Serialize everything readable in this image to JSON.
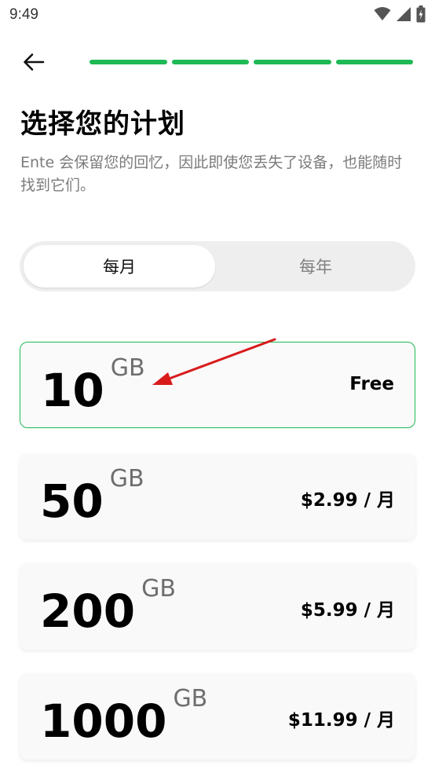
{
  "status_bar": {
    "time": "9:49",
    "icons": [
      "wifi-icon",
      "signal-icon",
      "battery-charging-icon"
    ]
  },
  "app_bar": {
    "back_icon": "arrow-left-icon",
    "progress_steps_total": 4,
    "progress_steps_completed": 4,
    "accent_color": "#1DB954"
  },
  "header": {
    "title": "选择您的计划",
    "subtitle": "Ente 会保留您的回忆，因此即使您丢失了设备，也能随时找到它们。"
  },
  "billing_toggle": {
    "options": [
      {
        "label": "每月",
        "selected": true
      },
      {
        "label": "每年",
        "selected": false
      }
    ]
  },
  "plans": [
    {
      "amount": "10",
      "unit": "GB",
      "price": "Free",
      "selected": true
    },
    {
      "amount": "50",
      "unit": "GB",
      "price": "$2.99 / 月",
      "selected": false
    },
    {
      "amount": "200",
      "unit": "GB",
      "price": "$5.99 / 月",
      "selected": false
    },
    {
      "amount": "1000",
      "unit": "GB",
      "price": "$11.99 / 月",
      "selected": false
    }
  ],
  "annotation": {
    "arrow_color": "#D81B1B",
    "target": "plan-10gb"
  }
}
